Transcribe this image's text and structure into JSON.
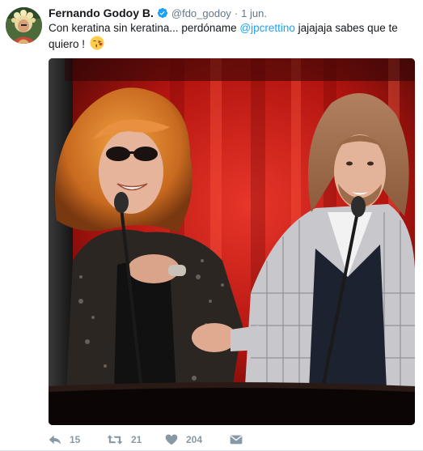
{
  "tweet": {
    "author": {
      "name": "Fernando Godoy B.",
      "handle": "@fdo_godoy",
      "verified": true
    },
    "separator": "·",
    "time": "1 jun.",
    "text": {
      "part1": "Con keratina sin keratina... perdóname ",
      "mention": "@jpcrettino",
      "part2": " jajajaja sabes que te quiero !"
    },
    "emoji": "kissing-face-heart",
    "actions": {
      "replies": "15",
      "retweets": "21",
      "likes": "204"
    },
    "colors": {
      "link": "#1da1f2",
      "verified": "#1da1f2",
      "muted": "#657786",
      "action": "#8899a6"
    }
  }
}
